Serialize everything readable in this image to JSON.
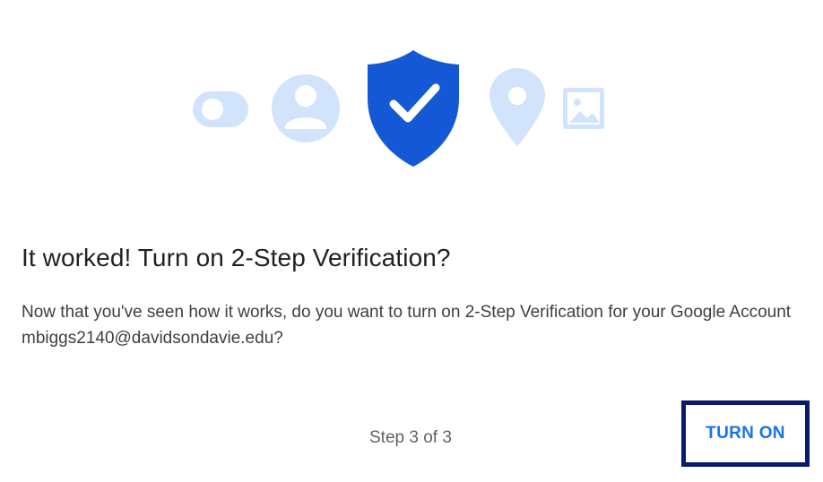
{
  "dialog": {
    "title": "It worked! Turn on 2-Step Verification?",
    "body": "Now that you've seen how it works, do you want to turn on 2-Step Verification for your Google Account mbiggs2140@davidsondavie.edu?",
    "step_indicator": "Step 3 of 3",
    "turn_on_label": "TURN ON"
  },
  "illustration": {
    "icons": [
      "toggle-icon",
      "person-icon",
      "shield-check-icon",
      "location-pin-icon",
      "image-icon"
    ]
  },
  "colors": {
    "accent": "#1a73e8",
    "shield": "#1558d6",
    "icon_light": "#d2e3fc",
    "highlight_border": "#0a1a6b"
  }
}
